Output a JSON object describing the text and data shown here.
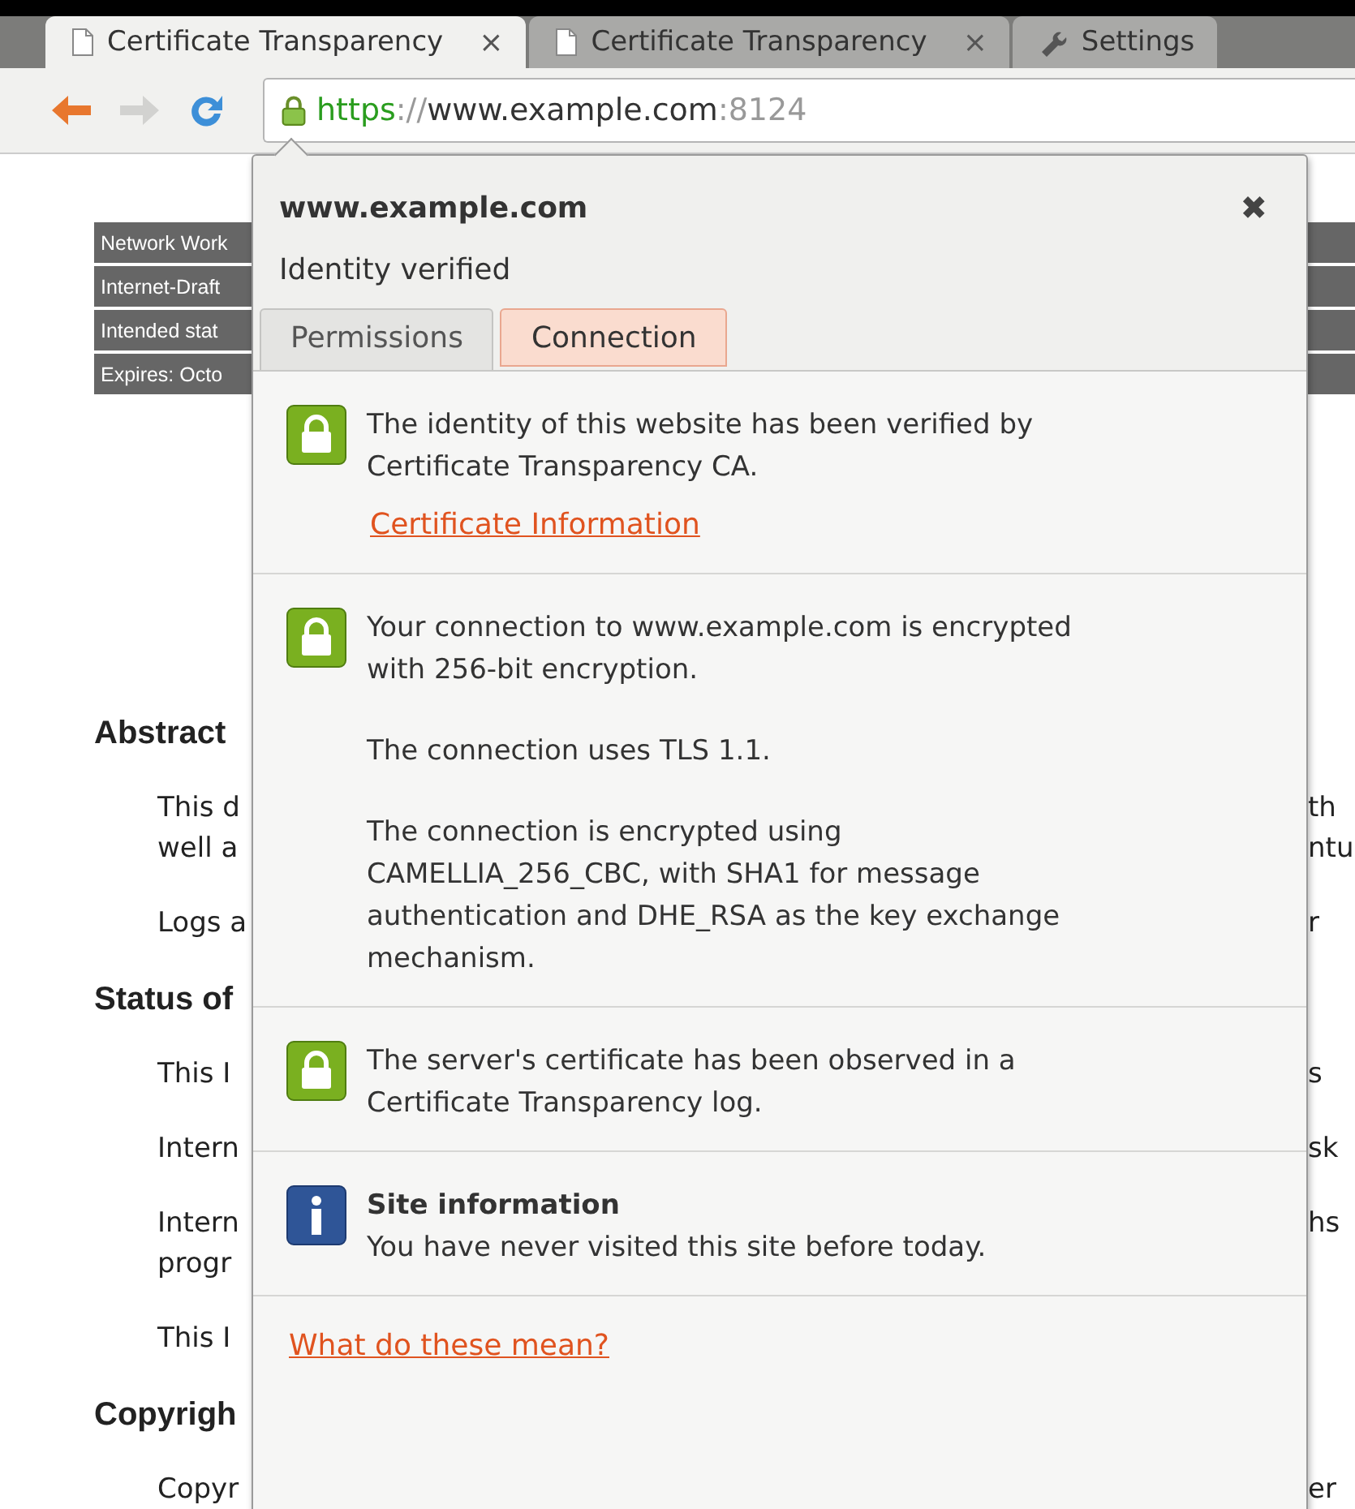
{
  "tabs": [
    {
      "title": "Certificate Transparency",
      "kind": "page",
      "selected": true,
      "close": "×"
    },
    {
      "title": "Certificate Transparency",
      "kind": "page",
      "selected": false,
      "close": "×"
    },
    {
      "title": "Settings",
      "kind": "settings",
      "selected": false
    }
  ],
  "toolbar": {
    "back_enabled": true,
    "forward_enabled": false
  },
  "address": {
    "secure": true,
    "scheme": "https",
    "separator": "://",
    "host": "www.example.com",
    "port": ":8124"
  },
  "page": {
    "header_rows": [
      "Network Work",
      "Internet-Draft",
      "Intended stat",
      "Expires: Octo"
    ],
    "blocks": [
      {
        "kind": "heading",
        "left": "Abstract"
      },
      {
        "kind": "para",
        "lines": [
          {
            "left": "This d",
            "right": "th"
          },
          {
            "left": "well a",
            "right": "ntu"
          }
        ]
      },
      {
        "kind": "para",
        "lines": [
          {
            "left": "Logs a",
            "right": "r"
          }
        ]
      },
      {
        "kind": "heading",
        "left": "Status of"
      },
      {
        "kind": "para",
        "lines": [
          {
            "left": "This I",
            "right": "s"
          }
        ]
      },
      {
        "kind": "para",
        "lines": [
          {
            "left": "Intern",
            "right": "sk"
          }
        ]
      },
      {
        "kind": "para",
        "lines": [
          {
            "left": "Intern",
            "right": "hs"
          },
          {
            "left": "progr"
          }
        ]
      },
      {
        "kind": "para",
        "lines": [
          {
            "left": "This I"
          }
        ]
      },
      {
        "kind": "heading",
        "left": "Copyrigh"
      },
      {
        "kind": "para",
        "lines": [
          {
            "left": "Copyr",
            "right": "er"
          }
        ]
      }
    ]
  },
  "popup": {
    "host": "www.example.com",
    "close": "✖",
    "status": "Identity verified",
    "tabs": [
      {
        "label": "Permissions",
        "selected": false
      },
      {
        "label": "Connection",
        "selected": true
      }
    ],
    "sections": [
      {
        "kind": "lock",
        "paragraphs": [
          "The identity of this website has been verified by Certificate Transparency CA."
        ],
        "link": "Certificate Information"
      },
      {
        "kind": "lock",
        "paragraphs": [
          "Your connection to www.example.com is encrypted with 256-bit encryption.",
          "The connection uses TLS 1.1.",
          "The connection is encrypted using CAMELLIA_256_CBC, with SHA1 for message authentication and DHE_RSA as the key exchange mechanism."
        ]
      },
      {
        "kind": "lock",
        "paragraphs": [
          "The server's certificate has been observed in a Certificate Transparency log."
        ]
      },
      {
        "kind": "info",
        "title": "Site information",
        "paragraphs": [
          "You have never visited this site before today."
        ]
      }
    ],
    "footer_link": "What do these mean?"
  }
}
